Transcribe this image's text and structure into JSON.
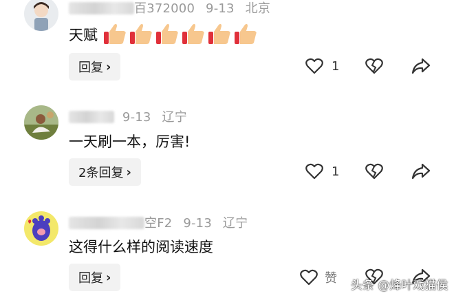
{
  "comments": [
    {
      "name_visible": "百372000",
      "date": "9-13",
      "location": "北京",
      "text": "天赋",
      "reply_label": "回复",
      "like_count": "1"
    },
    {
      "name_visible": "",
      "date": "9-13",
      "location": "辽宁",
      "text": "一天刷一本，厉害!",
      "reply_label": "2条回复",
      "like_count": "1"
    },
    {
      "name_visible": "空F2",
      "date": "9-13",
      "location": "辽宁",
      "text": "这得什么样的阅读速度",
      "reply_label": "回复",
      "like_label": "赞"
    }
  ],
  "watermark": "头条 @烽叶戏猫侯",
  "colors": {
    "meta": "#9a9a9a",
    "reply_bg": "#f2f2f2",
    "icon": "#333333"
  },
  "icons": [
    "heart-icon",
    "broken-heart-icon",
    "share-icon",
    "thumbs-up-emoji",
    "chevron-right-icon"
  ]
}
